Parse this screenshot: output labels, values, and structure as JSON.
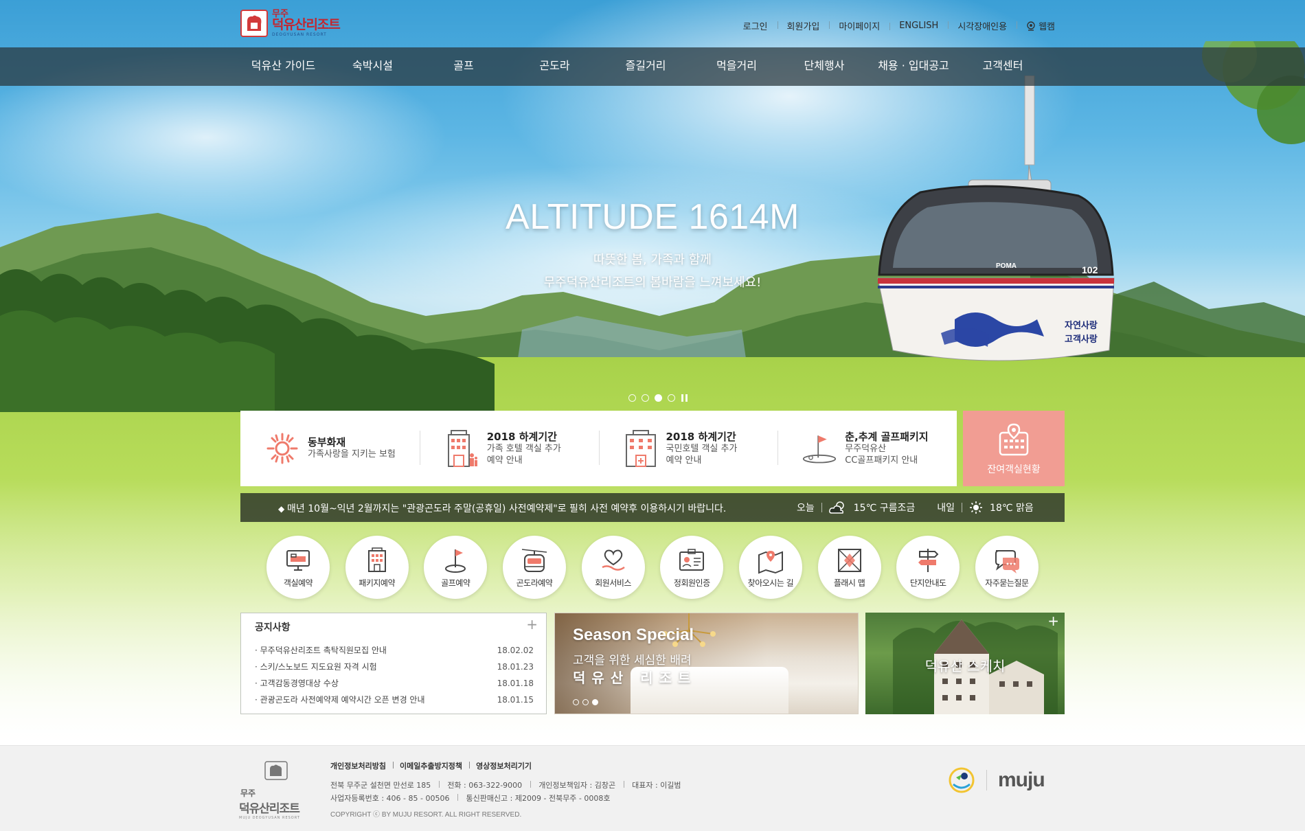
{
  "header": {
    "logo": {
      "small": "무주",
      "big": "덕유산리조트",
      "sub": "DEOGYUSAN RESORT"
    },
    "util": [
      {
        "label": "로그인"
      },
      {
        "label": "회원가입"
      },
      {
        "label": "마이페이지"
      },
      {
        "label": "ENGLISH"
      },
      {
        "label": "시각장애인용"
      },
      {
        "label": "웹캠"
      }
    ]
  },
  "gnb": [
    {
      "label": "덕유산 가이드"
    },
    {
      "label": "숙박시설"
    },
    {
      "label": "골프"
    },
    {
      "label": "곤도라"
    },
    {
      "label": "즐길거리"
    },
    {
      "label": "먹을거리"
    },
    {
      "label": "단체행사"
    },
    {
      "label": "채용 · 입대공고"
    },
    {
      "label": "고객센터"
    }
  ],
  "hero": {
    "title": "ALTITUDE 1614M",
    "line1": "따뜻한 봄, 가족과 함께",
    "line2": "무주덕유산리조트의 봄바람을 느껴보세요!",
    "gondola_brand": "POMA",
    "gondola_number": "102",
    "gondola_text1": "자연사랑",
    "gondola_text2": "고객사랑",
    "active_slide": 3,
    "slide_count": 4
  },
  "quick": [
    {
      "icon": "sun-emblem-icon",
      "title": "동부화재",
      "desc": "가족사랑을 지키는 보험"
    },
    {
      "icon": "hotel-family-icon",
      "title": "2018 하계기간",
      "desc": "가족 호텔 객실 추가",
      "desc2": "예약 안내"
    },
    {
      "icon": "hotel-building-icon",
      "title": "2018 하계기간",
      "desc": "국민호텔 객실 추가",
      "desc2": "예약 안내"
    },
    {
      "icon": "golf-flag-icon",
      "title": "춘,추계 골프패키지",
      "desc": "무주덕유산",
      "desc2": "CC골프패키지 안내"
    }
  ],
  "room_status": {
    "label": "잔여객실현황"
  },
  "notice_bar": {
    "text": "매년 10월~익년 2월까지는 \"관광곤도라 주말(공휴일) 사전예약제\"로 필히 사전 예약후 이용하시기 바랍니다.",
    "today_label": "오늘",
    "today_weather": "15℃ 구름조금",
    "tomorrow_label": "내일",
    "tomorrow_weather": "18℃ 맑음"
  },
  "services": [
    {
      "icon": "room-bed-icon",
      "label": "객실예약"
    },
    {
      "icon": "package-building-icon",
      "label": "패키지예약"
    },
    {
      "icon": "golf-ball-icon",
      "label": "골프예약"
    },
    {
      "icon": "gondola-icon",
      "label": "곤도라예약"
    },
    {
      "icon": "heart-hand-icon",
      "label": "회원서비스"
    },
    {
      "icon": "member-card-icon",
      "label": "정회원인증"
    },
    {
      "icon": "map-pin-icon",
      "label": "찾아오시는 길"
    },
    {
      "icon": "flash-map-icon",
      "label": "플래시 맵"
    },
    {
      "icon": "signpost-icon",
      "label": "단지안내도"
    },
    {
      "icon": "speech-bubble-icon",
      "label": "자주묻는질문"
    }
  ],
  "notices": {
    "title": "공지사항",
    "items": [
      {
        "title": "무주덕유산리조트 촉탁직원모집 안내",
        "date": "18.02.02"
      },
      {
        "title": "스키/스노보드 지도요원 자격 시험",
        "date": "18.01.23"
      },
      {
        "title": "고객감동경영대상 수상",
        "date": "18.01.18"
      },
      {
        "title": "관광곤도라 사전예약제 예약시간 오픈 변경 안내",
        "date": "18.01.15"
      }
    ]
  },
  "season": {
    "title": "Season Special",
    "line1": "고객을 위한 세심한 배려",
    "line2": "덕유산 리조트",
    "active": 3,
    "count": 3
  },
  "sketch": {
    "label": "덕유산 스케치"
  },
  "footer": {
    "logo": {
      "small": "무주",
      "big": "덕유산리조트",
      "sub": "MUJU DEOGYUSAN RESORT"
    },
    "links": [
      {
        "label": "개인정보처리방침"
      },
      {
        "label": "이메일추출방지정책"
      },
      {
        "label": "영상정보처리기기"
      }
    ],
    "info1": [
      {
        "text": "전북 무주군 설천면 만선로 185"
      },
      {
        "text": "전화 : 063-322-9000"
      },
      {
        "text": "개인정보책임자 : 김창곤"
      },
      {
        "text": "대표자 : 이길범"
      }
    ],
    "info2": [
      {
        "text": "사업자등록번호 : 406 - 85 - 00506"
      },
      {
        "text": "통신판매신고 : 제2009 - 전북무주 - 0008호"
      }
    ],
    "copyright": "COPYRIGHT ⓒ BY MUJU RESORT. ALL RIGHT RESERVED.",
    "brand": "muju"
  },
  "colors": {
    "accent_pink": "#f19d93",
    "brand_red": "#c3262f",
    "nav_bg": "#28343a"
  }
}
